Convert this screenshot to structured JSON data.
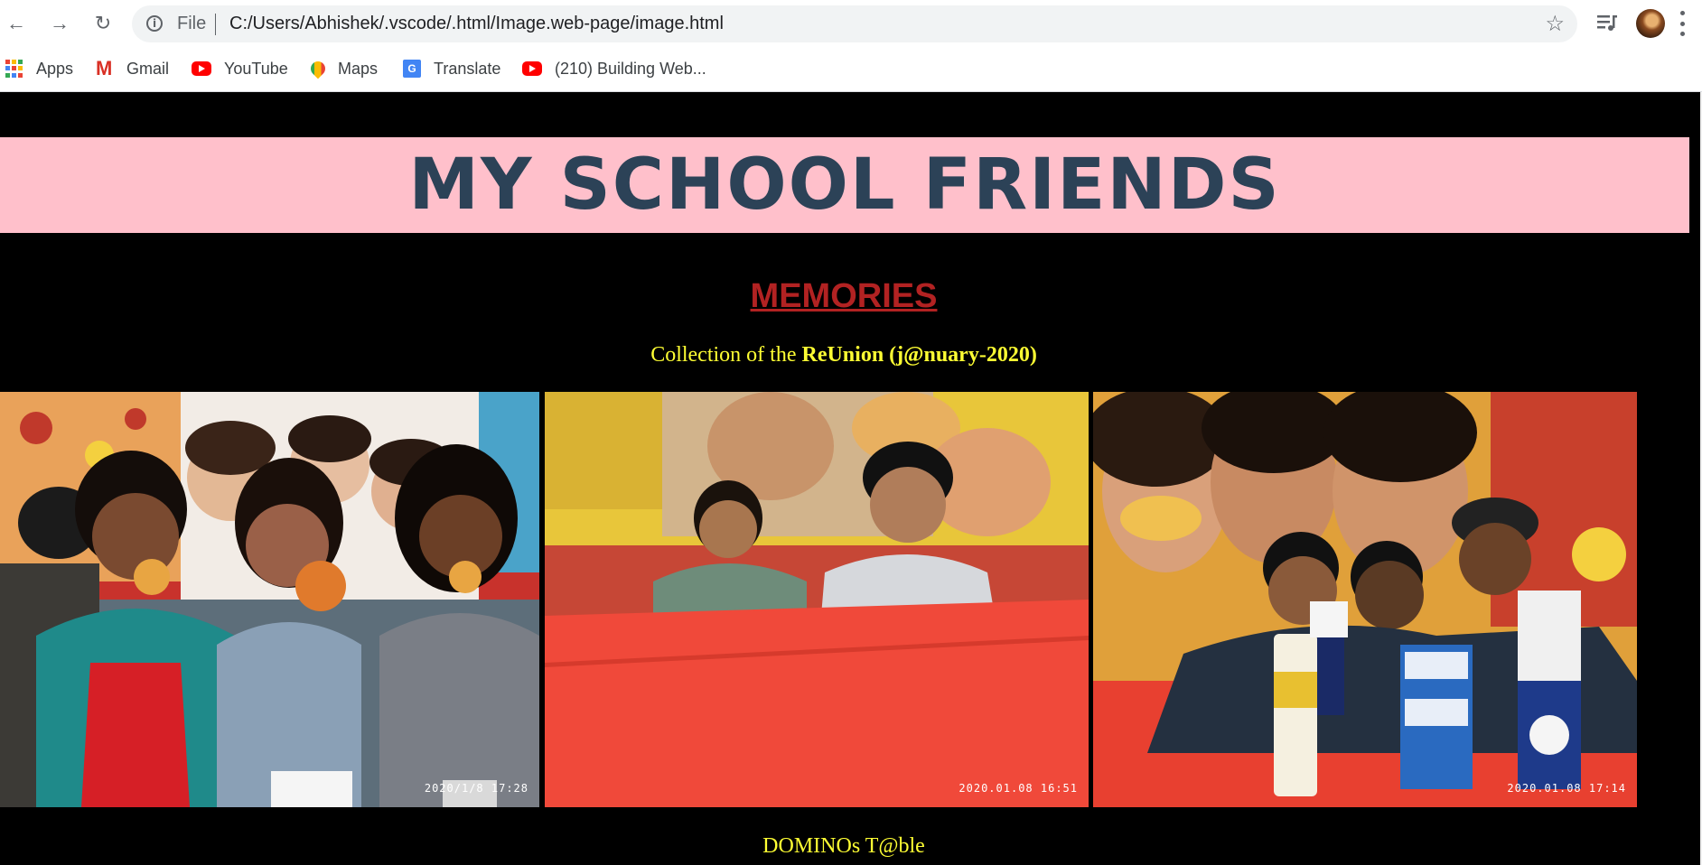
{
  "browser": {
    "info_label": "i",
    "file_label": "File",
    "url": "C:/Users/Abhishek/.vscode/.html/Image.web-page/image.html"
  },
  "bookmarks": [
    {
      "label": "Apps",
      "icon": "apps-grid-icon"
    },
    {
      "label": "Gmail",
      "icon": "gmail-icon"
    },
    {
      "label": "YouTube",
      "icon": "youtube-icon"
    },
    {
      "label": "Maps",
      "icon": "maps-icon"
    },
    {
      "label": "Translate",
      "icon": "translate-icon"
    },
    {
      "label": "(210) Building Web...",
      "icon": "youtube-icon"
    }
  ],
  "page": {
    "title": "MY SCHOOL FRIENDS",
    "heading": "MEMORIES",
    "caption_prefix": "Collection of the ",
    "caption_bold": "ReUnion (j@nuary-2020)",
    "photos": [
      {
        "timestamp": "2020/1/8 17:28"
      },
      {
        "timestamp": "2020.01.08 16:51"
      },
      {
        "timestamp": "2020.01.08 17:14"
      }
    ],
    "footer_caption": "DOMINOs T@ble"
  },
  "colors": {
    "banner_bg": "#ffc0cb",
    "title": "#2c4257",
    "heading": "#b22222",
    "caption": "#ffff33",
    "page_bg": "#000000"
  }
}
